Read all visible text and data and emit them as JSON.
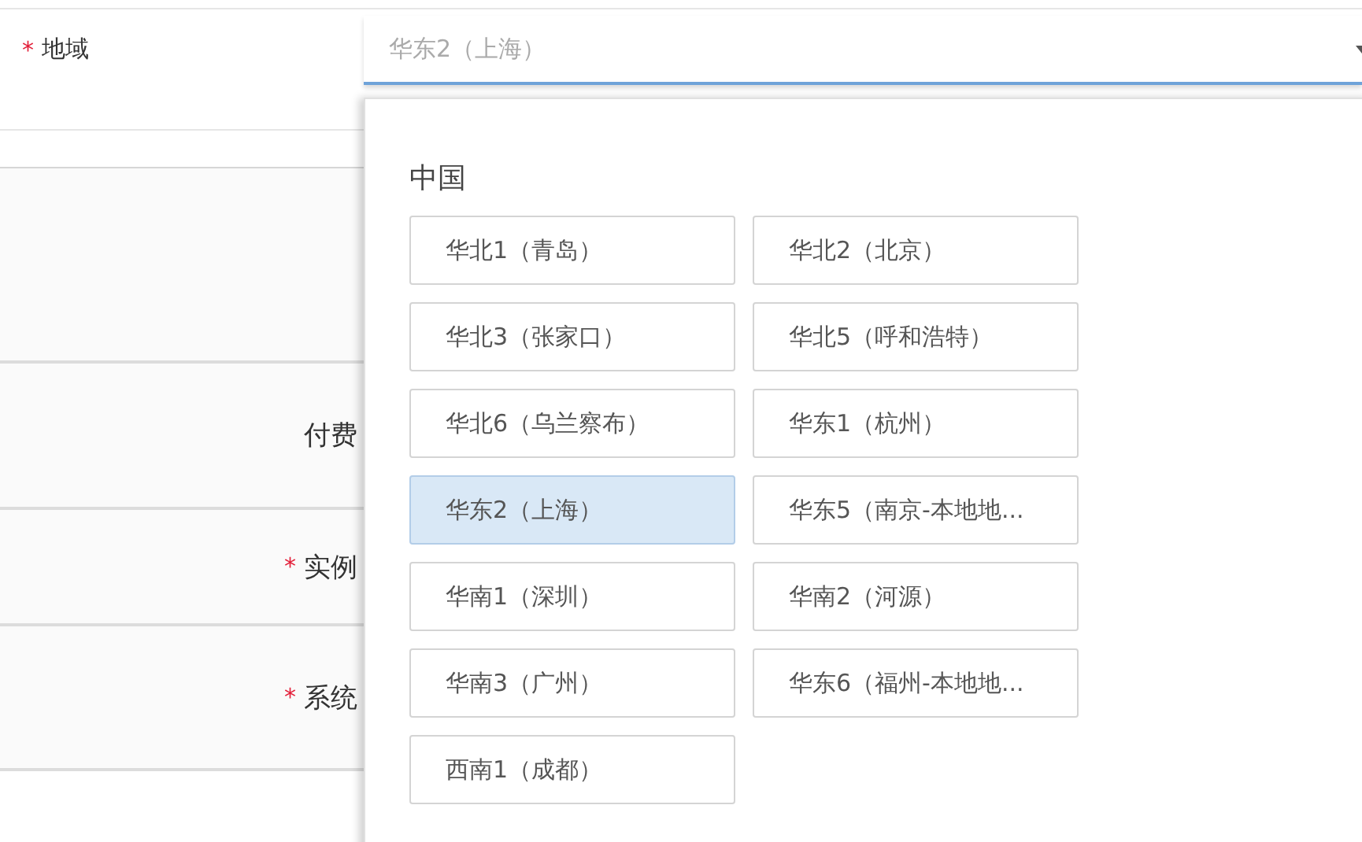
{
  "region_field": {
    "mark": "*",
    "label": "地域",
    "value": "华东2（上海）"
  },
  "form_rows": [
    {
      "label": "付费"
    },
    {
      "mark": "*",
      "label": "实例"
    },
    {
      "mark": "*",
      "label": "系统"
    }
  ],
  "dropdown": {
    "group": "中国",
    "options": [
      {
        "label": "华北1（青岛）",
        "selected": false
      },
      {
        "label": "华北2（北京）",
        "selected": false
      },
      {
        "label": "华北3（张家口）",
        "selected": false
      },
      {
        "label": "华北5（呼和浩特）",
        "selected": false
      },
      {
        "label": "华北6（乌兰察布）",
        "selected": false
      },
      {
        "label": "华东1（杭州）",
        "selected": false
      },
      {
        "label": "华东2（上海）",
        "selected": true
      },
      {
        "label": "华东5（南京-本地地...",
        "selected": false
      },
      {
        "label": "华南1（深圳）",
        "selected": false
      },
      {
        "label": "华南2（河源）",
        "selected": false
      },
      {
        "label": "华南3（广州）",
        "selected": false
      },
      {
        "label": "华东6（福州-本地地...",
        "selected": false
      },
      {
        "label": "西南1（成都）",
        "selected": false
      }
    ]
  }
}
